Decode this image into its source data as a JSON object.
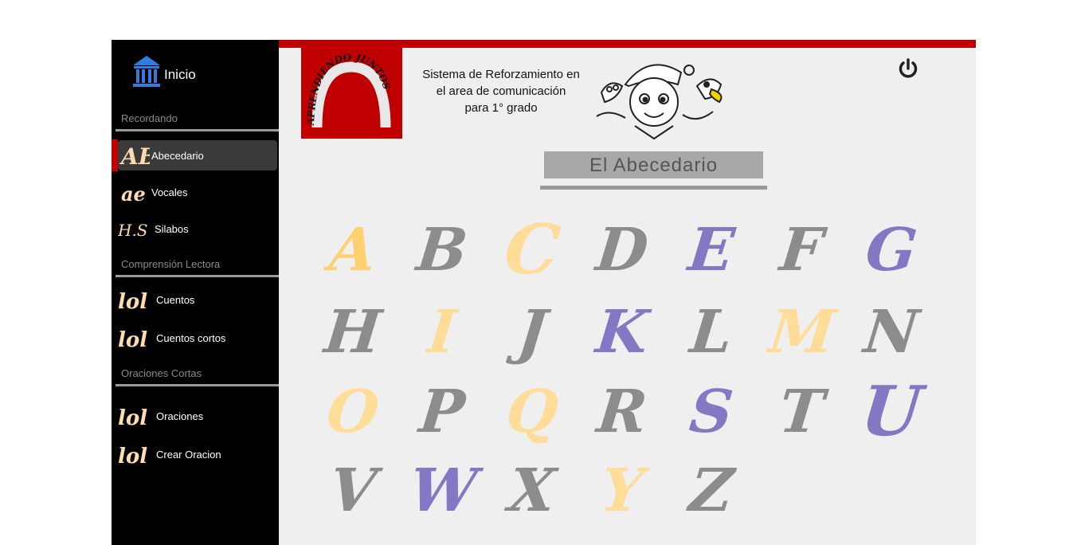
{
  "sidebar": {
    "home_label": "Inicio",
    "sections": [
      {
        "title": "Recordando",
        "items": [
          {
            "label": "Abecedario",
            "icon": "abc-icon",
            "active": true
          },
          {
            "label": "Vocales",
            "icon": "vowels-icon"
          },
          {
            "label": "Silabos",
            "icon": "syllables-icon"
          }
        ]
      },
      {
        "title": "Comprensión Lectora",
        "items": [
          {
            "label": "Cuentos",
            "icon": "story-icon"
          },
          {
            "label": "Cuentos cortos",
            "icon": "story-icon"
          }
        ]
      },
      {
        "title": "Oraciones Cortas",
        "items": [
          {
            "label": "Oraciones",
            "icon": "sentence-icon"
          },
          {
            "label": "Crear Oracion",
            "icon": "sentence-icon"
          }
        ]
      }
    ]
  },
  "header": {
    "logo_text": "APRENDIENDO JUNTOS",
    "subtitle_lines": [
      "Sistema de Reforzamiento en",
      "el area de comunicación",
      "para 1° grado"
    ],
    "power_icon": "power-icon"
  },
  "page_title": "El  Abecedario",
  "colors": {
    "accent": "#c00000",
    "yellow": "#ffd98a",
    "gray": "#8c8c8c",
    "purple": "#8478c4"
  },
  "letters": [
    {
      "char": "A",
      "color": "#ffd070"
    },
    {
      "char": "B",
      "color": "#8c8c8c"
    },
    {
      "char": "C",
      "color": "#ffdc98"
    },
    {
      "char": "D",
      "color": "#8c8c8c"
    },
    {
      "char": "E",
      "color": "#8478c4"
    },
    {
      "char": "F",
      "color": "#8c8c8c"
    },
    {
      "char": "G",
      "color": "#8478c4"
    },
    {
      "char": "H",
      "color": "#8c8c8c"
    },
    {
      "char": "I",
      "color": "#ffdc98"
    },
    {
      "char": "J",
      "color": "#8c8c8c"
    },
    {
      "char": "K",
      "color": "#8478c4"
    },
    {
      "char": "L",
      "color": "#8c8c8c"
    },
    {
      "char": "M",
      "color": "#ffdc98"
    },
    {
      "char": "N",
      "color": "#8c8c8c"
    },
    {
      "char": "O",
      "color": "#ffdc98"
    },
    {
      "char": "P",
      "color": "#8c8c8c"
    },
    {
      "char": "Q",
      "color": "#ffdc98"
    },
    {
      "char": "R",
      "color": "#8c8c8c"
    },
    {
      "char": "S",
      "color": "#8478c4"
    },
    {
      "char": "T",
      "color": "#8c8c8c"
    },
    {
      "char": "U",
      "color": "#8478c4"
    },
    {
      "char": "V",
      "color": "#8c8c8c"
    },
    {
      "char": "W",
      "color": "#8478c4"
    },
    {
      "char": "X",
      "color": "#8c8c8c"
    },
    {
      "char": "Y",
      "color": "#ffdc98"
    },
    {
      "char": "Z",
      "color": "#8c8c8c"
    }
  ]
}
